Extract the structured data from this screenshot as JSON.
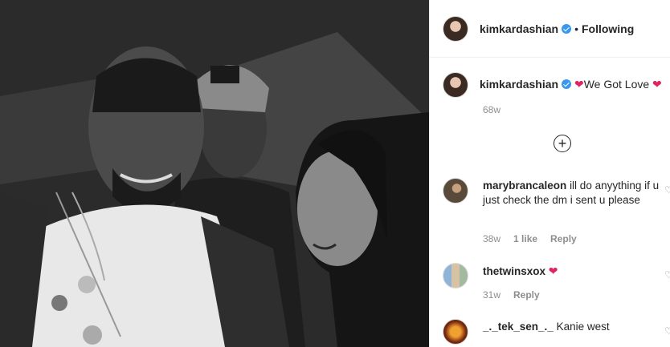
{
  "post": {
    "author": "kimkardashian",
    "follow_status": "Following",
    "separator": "•"
  },
  "caption": {
    "username": "kimkardashian",
    "heart_left": "❤",
    "text": "We Got Love",
    "heart_right": "❤",
    "time": "68w"
  },
  "load_more_symbol": "+",
  "comments": [
    {
      "username": "marybrancaleon",
      "text": "ill do anyything if u just check the dm i sent u please",
      "time": "38w",
      "likes": "1 like",
      "reply": "Reply"
    },
    {
      "username": "thetwinsxox",
      "text": "❤",
      "time": "31w",
      "reply": "Reply"
    },
    {
      "username": "_._tek_sen_._",
      "text": "Kanie west"
    }
  ],
  "colors": {
    "verified": "#3897f0",
    "heart": "#e0245e",
    "muted": "#8e8e8e",
    "text": "#262626"
  },
  "icons": {
    "verified": "verified-badge-icon",
    "load_more": "plus-circle-icon",
    "comment_like": "heart-outline-icon"
  }
}
